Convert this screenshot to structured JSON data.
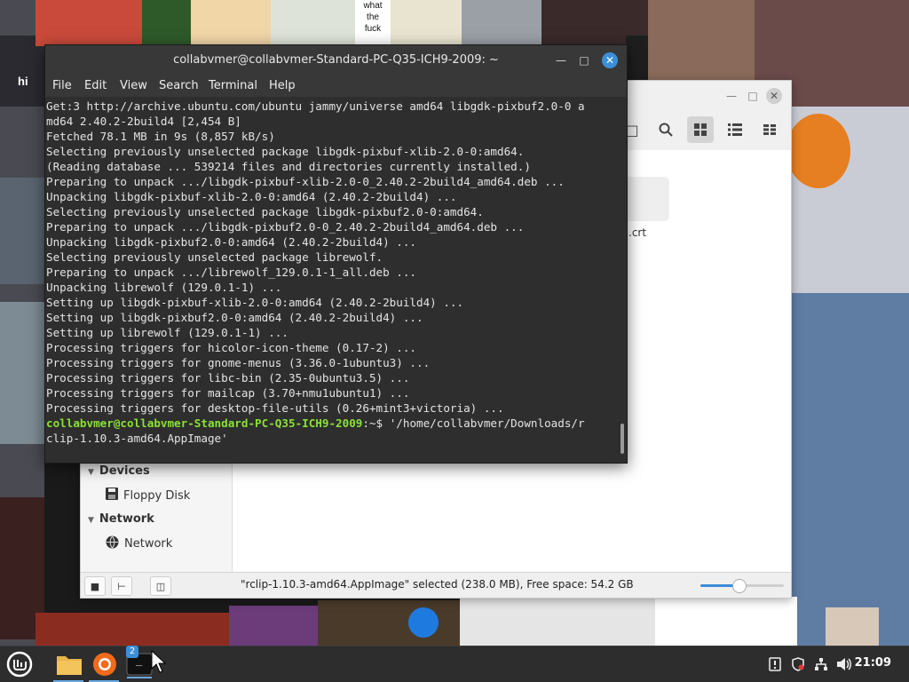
{
  "desktop": {
    "overlay_texts": [
      "hi",
      "what\nthe\nfuck"
    ]
  },
  "file_manager": {
    "sidebar": {
      "devices_header": "Devices",
      "devices": [
        {
          "label": "Floppy Disk",
          "icon": "floppy-disk-icon"
        }
      ],
      "network_header": "Network",
      "network": [
        {
          "label": "Network",
          "icon": "network-icon"
        }
      ]
    },
    "file_label": ".crt",
    "status_text": "\"rclip-1.10.3-amd64.AppImage\" selected (238.0 MB), Free space: 54.2 GB",
    "zoom_level": 0.46
  },
  "terminal": {
    "title": "collabvmer@collabvmer-Standard-PC-Q35-ICH9-2009: ~",
    "menu": [
      "File",
      "Edit",
      "View",
      "Search",
      "Terminal",
      "Help"
    ],
    "lines": [
      "Get:3 http://archive.ubuntu.com/ubuntu jammy/universe amd64 libgdk-pixbuf2.0-0 a",
      "md64 2.40.2-2build4 [2,454 B]",
      "Fetched 78.1 MB in 9s (8,857 kB/s)",
      "Selecting previously unselected package libgdk-pixbuf-xlib-2.0-0:amd64.",
      "(Reading database ... 539214 files and directories currently installed.)",
      "Preparing to unpack .../libgdk-pixbuf-xlib-2.0-0_2.40.2-2build4_amd64.deb ...",
      "Unpacking libgdk-pixbuf-xlib-2.0-0:amd64 (2.40.2-2build4) ...",
      "Selecting previously unselected package libgdk-pixbuf2.0-0:amd64.",
      "Preparing to unpack .../libgdk-pixbuf2.0-0_2.40.2-2build4_amd64.deb ...",
      "Unpacking libgdk-pixbuf2.0-0:amd64 (2.40.2-2build4) ...",
      "Selecting previously unselected package librewolf.",
      "Preparing to unpack .../librewolf_129.0.1-1_all.deb ...",
      "Unpacking librewolf (129.0.1-1) ...",
      "Setting up libgdk-pixbuf-xlib-2.0-0:amd64 (2.40.2-2build4) ...",
      "Setting up libgdk-pixbuf2.0-0:amd64 (2.40.2-2build4) ...",
      "Setting up librewolf (129.0.1-1) ...",
      "Processing triggers for hicolor-icon-theme (0.17-2) ...",
      "Processing triggers for gnome-menus (3.36.0-1ubuntu3) ...",
      "Processing triggers for libc-bin (2.35-0ubuntu3.5) ...",
      "Processing triggers for mailcap (3.70+nmu1ubuntu1) ...",
      "Processing triggers for desktop-file-utils (0.26+mint3+victoria) ..."
    ],
    "prompt": "collabvmer@collabvmer-Standard-PC-Q35-ICH9-2009",
    "prompt_suffix": ":~$ ",
    "command": "'/home/collabvmer/Downloads/r",
    "command_cont": "clip-1.10.3-amd64.AppImage'"
  },
  "taskbar": {
    "apps": [
      {
        "name": "mint-menu-icon"
      },
      {
        "name": "files-icon"
      },
      {
        "name": "firefox-icon"
      },
      {
        "name": "terminal-icon"
      }
    ],
    "terminal_badge": "2",
    "terminal_glyph": "_",
    "clock": "21:09"
  }
}
